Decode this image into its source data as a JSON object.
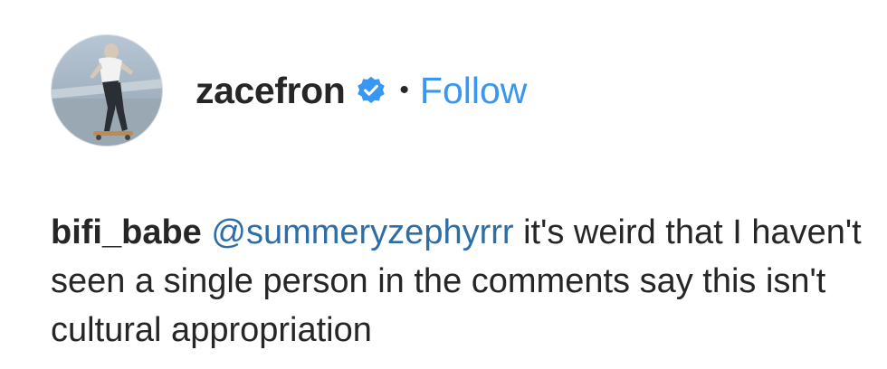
{
  "post_header": {
    "username": "zacefron",
    "verified": true,
    "separator": "•",
    "follow_label": "Follow"
  },
  "comment": {
    "username": "bifi_babe",
    "mention": "@summeryzephyrrr",
    "text": "it's weird that I haven't seen a single person in the comments say this isn't cultural appropriation"
  },
  "colors": {
    "follow_link": "#3897f0",
    "mention_link": "#2e6ea6",
    "text": "#262626",
    "verified_badge": "#3897f0"
  },
  "icons": {
    "verified": "verified-badge-icon"
  }
}
